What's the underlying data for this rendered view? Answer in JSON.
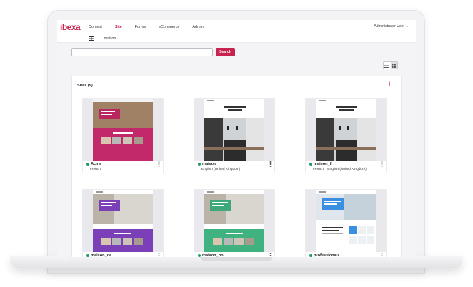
{
  "app": {
    "logo_text": "ibexa",
    "brand_color": "#c8234f"
  },
  "topnav": {
    "items": [
      {
        "label": "Content",
        "active": false
      },
      {
        "label": "Site",
        "active": true
      },
      {
        "label": "Forms",
        "active": false
      },
      {
        "label": "eCommerce",
        "active": false
      },
      {
        "label": "Admin",
        "active": false
      }
    ],
    "user_label": "Administrator User"
  },
  "subbar": {
    "label": "maison",
    "icon": "grid-icon"
  },
  "search": {
    "placeholder": "",
    "value": "",
    "button_label": "Search"
  },
  "view_toggle": {
    "options": [
      "list-view-icon",
      "grid-view-icon"
    ],
    "selected": "grid-view-icon"
  },
  "sites": {
    "title": "Sites (9)",
    "add_icon": "plus-icon",
    "cards": [
      {
        "name": "Acme",
        "languages": [
          "French"
        ],
        "theme": "magenta-hero"
      },
      {
        "name": "maison",
        "languages": [
          "English (United Kingdom)"
        ],
        "theme": "kitchen"
      },
      {
        "name": "maison_fr",
        "languages": [
          "French",
          "English (United Kingdom)"
        ],
        "theme": "kitchen"
      },
      {
        "name": "maison_de",
        "languages": [],
        "theme": "purple"
      },
      {
        "name": "maison_no",
        "languages": [],
        "theme": "green"
      },
      {
        "name": "professionals",
        "languages": [],
        "theme": "blue"
      }
    ]
  }
}
